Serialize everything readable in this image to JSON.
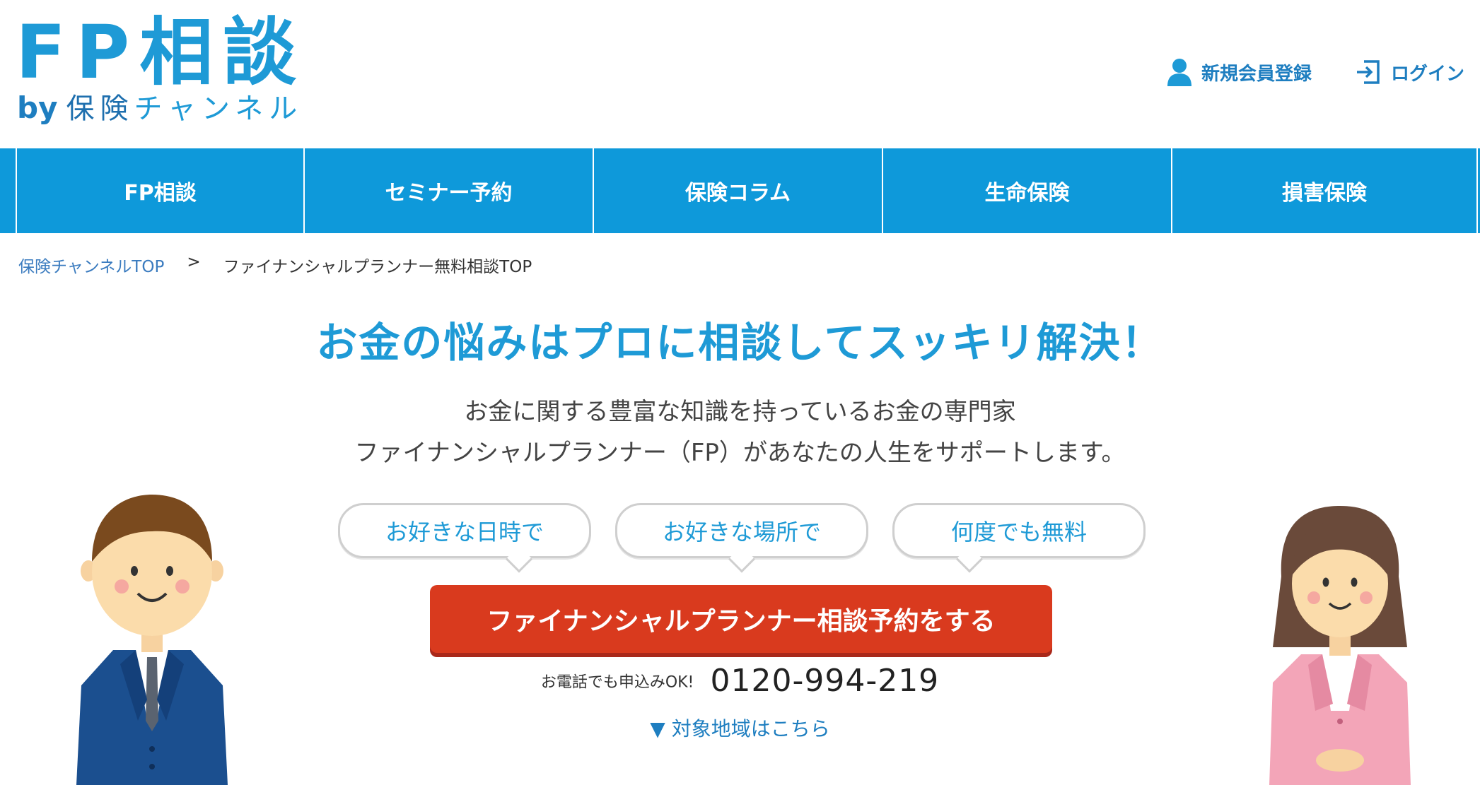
{
  "header": {
    "logo": {
      "main": "FP相談",
      "by": "by",
      "ins": "保険",
      "channel": "チャンネル"
    },
    "links": [
      {
        "label": "新規会員登録",
        "icon": "user-icon"
      },
      {
        "label": "ログイン",
        "icon": "login-icon"
      }
    ]
  },
  "nav": {
    "items": [
      "FP相談",
      "セミナー予約",
      "保険コラム",
      "生命保険",
      "損害保険"
    ]
  },
  "breadcrumb": {
    "home": "保険チャンネルTOP",
    "separator": ">",
    "current": "ファイナンシャルプランナー無料相談TOP"
  },
  "hero": {
    "headline": "お金の悩みはプロに相談してスッキリ解決！",
    "lead_line1": "お金に関する豊富な知識を持っているお金の専門家",
    "lead_line2": "ファイナンシャルプランナー（FP）があなたの人生をサポートします。",
    "bubbles": [
      "お好きな日時で",
      "お好きな場所で",
      "何度でも無料"
    ],
    "cta_label": "ファイナンシャルプランナー相談予約をする",
    "phone_label": "お電話でも申込みOK!",
    "phone_number": "0120-994-219",
    "region_link": "▼ 対象地域はこちら"
  },
  "colors": {
    "brand": "#1e9ad6",
    "nav": "#0e99da",
    "cta": "#d93a1e"
  }
}
